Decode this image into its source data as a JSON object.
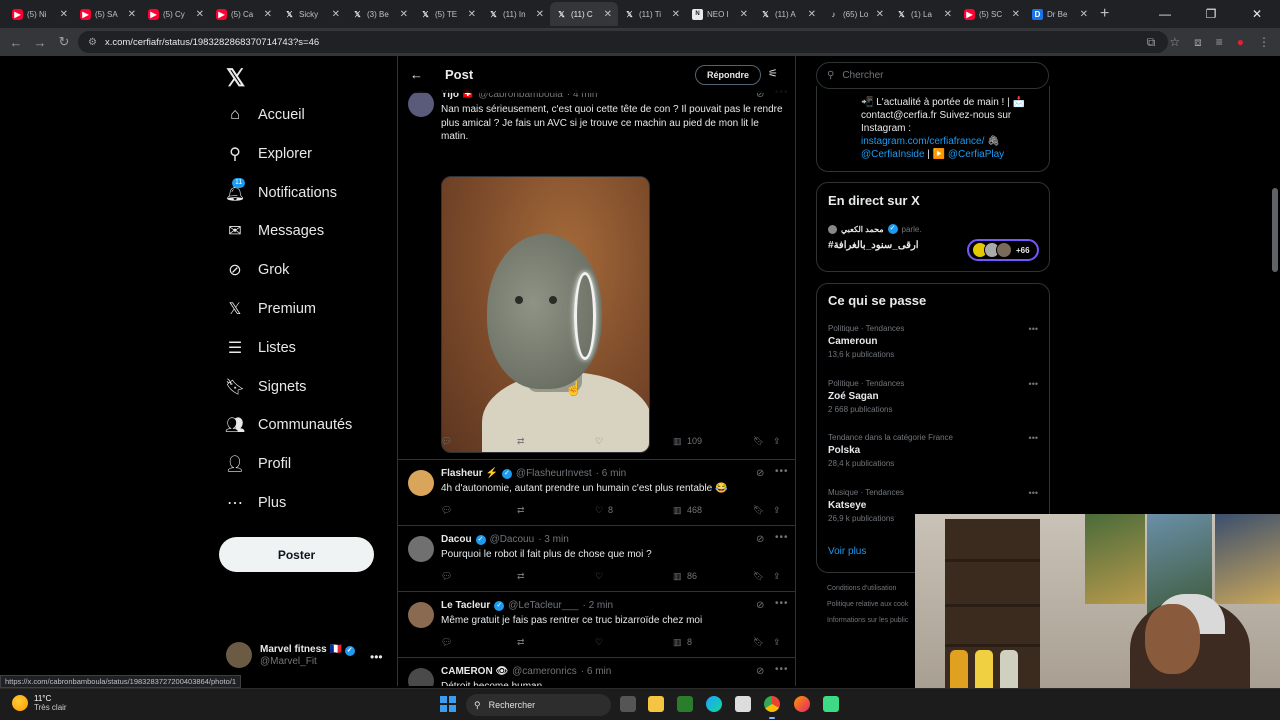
{
  "browser": {
    "tabs": [
      {
        "label": "(5) Ni",
        "icon": "youtube-icon",
        "kind": "yt"
      },
      {
        "label": "(5) SA",
        "icon": "youtube-icon",
        "kind": "yt"
      },
      {
        "label": "(5) Cy",
        "icon": "youtube-icon",
        "kind": "yt"
      },
      {
        "label": "(5) Ca",
        "icon": "youtube-icon",
        "kind": "yt"
      },
      {
        "label": "Sicky",
        "icon": "x-icon",
        "kind": "x"
      },
      {
        "label": "(3) Be",
        "icon": "x-icon",
        "kind": "x"
      },
      {
        "label": "(5) TE",
        "icon": "x-icon",
        "kind": "x"
      },
      {
        "label": "(11) In",
        "icon": "x-icon",
        "kind": "x"
      },
      {
        "label": "(11) C",
        "icon": "x-icon",
        "kind": "x",
        "active": true
      },
      {
        "label": "(11) Ti",
        "icon": "x-icon",
        "kind": "x"
      },
      {
        "label": "NEO I",
        "icon": "neo-icon",
        "kind": "neo"
      },
      {
        "label": "(11) A",
        "icon": "x-icon",
        "kind": "x"
      },
      {
        "label": "(65) Lo",
        "icon": "tiktok-icon",
        "kind": "tt"
      },
      {
        "label": "(1) La",
        "icon": "x-icon",
        "kind": "x"
      },
      {
        "label": "(5) SC",
        "icon": "youtube-icon",
        "kind": "yt"
      },
      {
        "label": "Dr Be",
        "icon": "db-icon",
        "kind": "db"
      }
    ],
    "url": "x.com/cerfiafr/status/1983282868370714743?s=46",
    "status_url": "https://x.com/cabronbamboula/status/1983283727200403864/photo/1"
  },
  "nav": {
    "items": [
      {
        "label": "Accueil",
        "icon": "home-icon",
        "glyph": "⌂"
      },
      {
        "label": "Explorer",
        "icon": "search-icon",
        "glyph": "⚲"
      },
      {
        "label": "Notifications",
        "icon": "bell-icon",
        "glyph": "🔔︎",
        "badge": "11"
      },
      {
        "label": "Messages",
        "icon": "envelope-icon",
        "glyph": "✉"
      },
      {
        "label": "Grok",
        "icon": "grok-icon",
        "glyph": "⊘"
      },
      {
        "label": "Premium",
        "icon": "x-premium-icon",
        "glyph": "𝕏"
      },
      {
        "label": "Listes",
        "icon": "list-icon",
        "glyph": "☰"
      },
      {
        "label": "Signets",
        "icon": "bookmark-icon",
        "glyph": "🔖︎"
      },
      {
        "label": "Communautés",
        "icon": "communities-icon",
        "glyph": "👥︎"
      },
      {
        "label": "Profil",
        "icon": "profile-icon",
        "glyph": "👤︎"
      },
      {
        "label": "Plus",
        "icon": "more-circle-icon",
        "glyph": "⋯"
      }
    ],
    "post_label": "Poster",
    "account": {
      "name": "Marvel fitness 🇫🇷",
      "handle": "@Marvel_Fit"
    }
  },
  "center": {
    "title": "Post",
    "reply_label": "Répondre",
    "tweets": [
      {
        "name": "Yijo 🇨🇭",
        "handle": "@cabronbamboula",
        "time": "· 4 min",
        "text": "Nan mais sérieusement, c'est quoi cette tête de con ? Il pouvait pas le rendre plus amical ? Je fais un AVC si je trouve ce machin au pied de mon lit le matin.",
        "likes": "",
        "views": "109",
        "replies": "",
        "retweets": ""
      },
      {
        "name": "Flasheur ⚡",
        "handle": "@FlasheurInvest",
        "time": "· 6 min",
        "text": "4h d'autonomie, autant prendre un humain c'est plus rentable 😂",
        "likes": "8",
        "views": "468",
        "replies": "",
        "retweets": ""
      },
      {
        "name": "Dacou",
        "handle": "@Dacouu",
        "time": "· 3 min",
        "text": "Pourquoi le robot il fait plus de chose que moi ?",
        "likes": "",
        "views": "86",
        "replies": "",
        "retweets": ""
      },
      {
        "name": "Le Tacleur",
        "handle": "@LeTacleur___",
        "time": "· 2 min",
        "text": "Même gratuit je fais pas rentrer ce truc bizarroïde chez moi",
        "likes": "",
        "views": "8",
        "replies": "",
        "retweets": ""
      },
      {
        "name": "CAMERON 👁",
        "handle": "@cameronrics",
        "time": "· 6 min",
        "text": "Détroit become human",
        "likes": "",
        "views": "",
        "replies": "",
        "retweets": ""
      }
    ]
  },
  "right": {
    "search_placeholder": "Chercher",
    "bio_line1": "📲 L'actualité à portée de main ! | 📩",
    "bio_line2": "contact@cerfia.fr Suivez-nous sur",
    "bio_line3": "Instagram :",
    "bio_link1": "instagram.com/cerfiafrance/",
    "bio_link1_suffix": " 🖇",
    "bio_link2": "@CerfiaInside",
    "bio_sep": " | ▶️ ",
    "bio_link3": "@CerfiaPlay",
    "live": {
      "heading": "En direct sur X",
      "host": "محمد الكعبي",
      "host_suffix": "parle.",
      "title": "#ارقى_سنود_بالغرافة",
      "listeners": "+66"
    },
    "trends_heading": "Ce qui se passe",
    "trends": [
      {
        "category": "Politique · Tendances",
        "name": "Cameroun",
        "count": "13,6 k publications"
      },
      {
        "category": "Politique · Tendances",
        "name": "Zoé Sagan",
        "count": "2 668 publications"
      },
      {
        "category": "Tendance dans la catégorie France",
        "name": "Polska",
        "count": "28,4 k publications"
      },
      {
        "category": "Musique · Tendances",
        "name": "Katseye",
        "count": "26,9 k publications"
      }
    ],
    "see_more": "Voir plus",
    "footer": [
      "Conditions d'utilisation",
      "Politique relative aux cook",
      "Informations sur les public"
    ]
  },
  "taskbar": {
    "temp": "11°C",
    "weather": "Très clair",
    "search_label": "Rechercher"
  },
  "colors": {
    "accent": "#1d9bf0",
    "bg": "#000000",
    "border": "#2f3336",
    "muted": "#71767b"
  }
}
